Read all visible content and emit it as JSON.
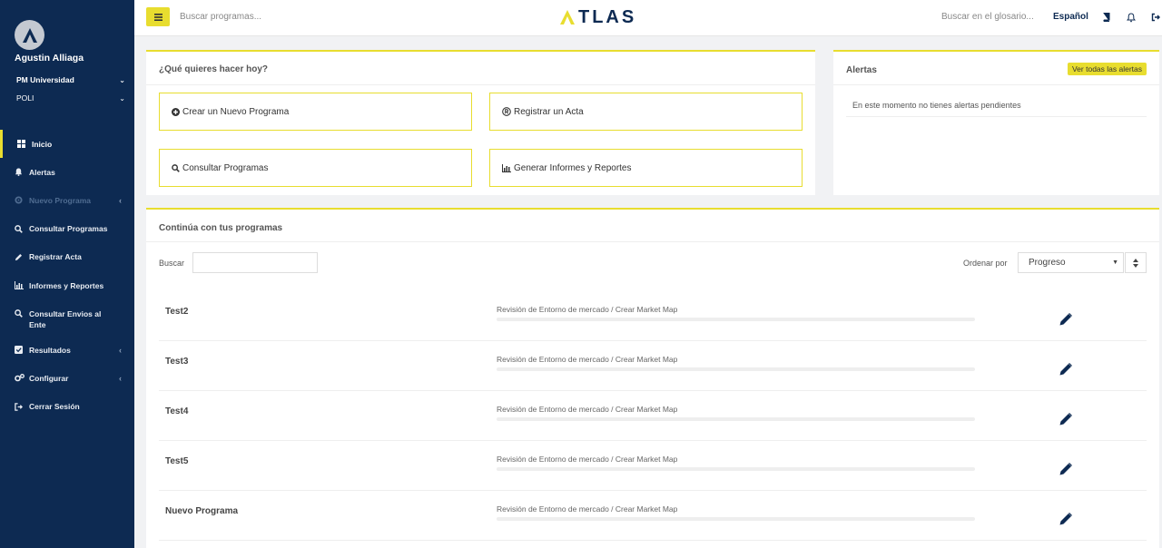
{
  "topbar": {
    "search_placeholder": "Buscar programas...",
    "logo_text": "TLAS",
    "glossary_placeholder": "Buscar en el glosario...",
    "language": "Español"
  },
  "user": {
    "name": "Agustin Alliaga",
    "university": "PM Universidad",
    "campus": "POLI"
  },
  "sidebar": {
    "items": [
      {
        "label": "Inicio",
        "icon": "grid-icon"
      },
      {
        "label": "Alertas",
        "icon": "bell-icon"
      },
      {
        "label": "Nuevo Programa",
        "icon": "gear-icon"
      },
      {
        "label": "Consultar Programas",
        "icon": "search-icon"
      },
      {
        "label": "Registrar Acta",
        "icon": "pencil-icon"
      },
      {
        "label": "Informes y Reportes",
        "icon": "bar-chart-icon"
      },
      {
        "label": "Consultar Envios al Ente",
        "icon": "search-icon"
      },
      {
        "label": "Resultados",
        "icon": "check-square-icon"
      },
      {
        "label": "Configurar",
        "icon": "gears-icon"
      },
      {
        "label": "Cerrar Sesión",
        "icon": "logout-icon"
      }
    ]
  },
  "actions": {
    "title": "¿Qué quieres hacer hoy?",
    "items": [
      {
        "label": "Crear un Nuevo Programa",
        "icon": "plus-circle-icon"
      },
      {
        "label": "Registrar un Acta",
        "icon": "registered-icon"
      },
      {
        "label": "Consultar Programas",
        "icon": "search-icon"
      },
      {
        "label": "Generar Informes y Reportes",
        "icon": "bar-chart-icon"
      }
    ]
  },
  "alerts": {
    "title": "Alertas",
    "view_all": "Ver todas las alertas",
    "empty_message": "En este momento no tienes alertas pendientes"
  },
  "programs": {
    "title": "Continúa con tus programas",
    "search_label": "Buscar",
    "search_value": "",
    "sort_label": "Ordenar por",
    "sort_value": "Progreso",
    "rows": [
      {
        "name": "Test2",
        "step": "Revisión de Entorno de mercado / Crear Market Map",
        "progress": 0
      },
      {
        "name": "Test3",
        "step": "Revisión de Entorno de mercado / Crear Market Map",
        "progress": 0
      },
      {
        "name": "Test4",
        "step": "Revisión de Entorno de mercado / Crear Market Map",
        "progress": 0
      },
      {
        "name": "Test5",
        "step": "Revisión de Entorno de mercado / Crear Market Map",
        "progress": 0
      },
      {
        "name": "Nuevo Programa",
        "step": "Revisión de Entorno de mercado / Crear Market Map",
        "progress": 0
      }
    ]
  },
  "colors": {
    "sidebar_bg": "#0d2a52",
    "accent": "#e8dd2f"
  }
}
